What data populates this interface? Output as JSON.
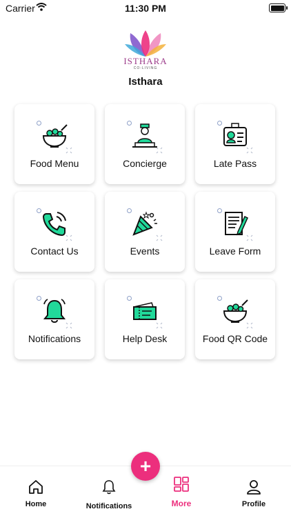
{
  "status_bar": {
    "carrier": "Carrier",
    "time": "11:30 PM"
  },
  "header": {
    "logo_text": "ISTHARA",
    "logo_subtext": "CO-LIVING",
    "org_name": "Isthara"
  },
  "tiles": [
    {
      "label": "Food Menu",
      "icon": "food-bowl-icon"
    },
    {
      "label": "Concierge",
      "icon": "concierge-icon"
    },
    {
      "label": "Late Pass",
      "icon": "id-card-icon"
    },
    {
      "label": "Contact Us",
      "icon": "phone-icon"
    },
    {
      "label": "Events",
      "icon": "party-popper-icon"
    },
    {
      "label": "Leave Form",
      "icon": "form-icon"
    },
    {
      "label": "Notifications",
      "icon": "bell-icon"
    },
    {
      "label": "Help Desk",
      "icon": "ticket-icon"
    },
    {
      "label": "Food QR Code",
      "icon": "food-bowl-icon"
    }
  ],
  "fab": {
    "label": "+"
  },
  "bottom_nav": [
    {
      "label": "Home",
      "icon": "home-icon",
      "active": false
    },
    {
      "label": "Notifications",
      "icon": "bell-icon",
      "active": false
    },
    {
      "label": "More",
      "icon": "grid-icon",
      "active": true
    },
    {
      "label": "Profile",
      "icon": "user-icon",
      "active": false
    }
  ],
  "colors": {
    "accent": "#ec2f7d",
    "icon_green": "#21d99a",
    "dot": "#8ea0c8"
  }
}
